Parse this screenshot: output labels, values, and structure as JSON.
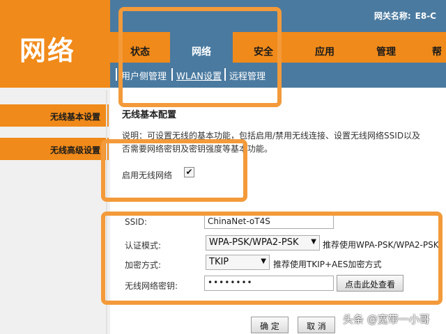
{
  "header": {
    "logo": "网络",
    "gateway_label": "网关名称:",
    "gateway_value": "E8-C"
  },
  "nav": {
    "tabs": [
      {
        "label": "状态"
      },
      {
        "label": "网络",
        "active": true
      },
      {
        "label": "安全"
      },
      {
        "label": "应用"
      },
      {
        "label": "管理"
      },
      {
        "label": "帮"
      }
    ]
  },
  "subnav": {
    "items": [
      {
        "label": "用户侧管理"
      },
      {
        "label": "WLAN设置",
        "active": true
      },
      {
        "label": "远程管理"
      }
    ]
  },
  "sidebar": {
    "items": [
      {
        "label": "无线基本设置"
      },
      {
        "label": "无线高级设置"
      }
    ]
  },
  "content": {
    "title": "无线基本配置",
    "desc_line1": "说明：可设置无线的基本功能，包括启用/禁用无线连接、设置无线网络SSID以及",
    "desc_line2": "否需要网络密钥及密钥强度等基本功能。",
    "enable_label": "启用无线网络",
    "enable_checked": true,
    "check_mark": "✔",
    "ssid_label": "SSID:",
    "ssid_value": "ChinaNet-oT4S",
    "auth_label": "认证模式:",
    "auth_value": "WPA-PSK/WPA2-PSK",
    "auth_hint": "推荐使用WPA-PSK/WPA2-PSK",
    "enc_label": "加密方式:",
    "enc_value": "TKIP",
    "enc_hint": "推荐使用TKIP+AES加密方式",
    "key_label": "无线网络密钥:",
    "key_value": "••••••••",
    "show_button": "点击此处查看",
    "ok_button": "确 定",
    "cancel_button": "取 消",
    "dropdown_arrow": "▼"
  },
  "watermark": "头条 @宽带一小哥",
  "colors": {
    "orange": "#f08a1a",
    "blue": "#4a7aa0",
    "highlight": "#f39a3a"
  }
}
